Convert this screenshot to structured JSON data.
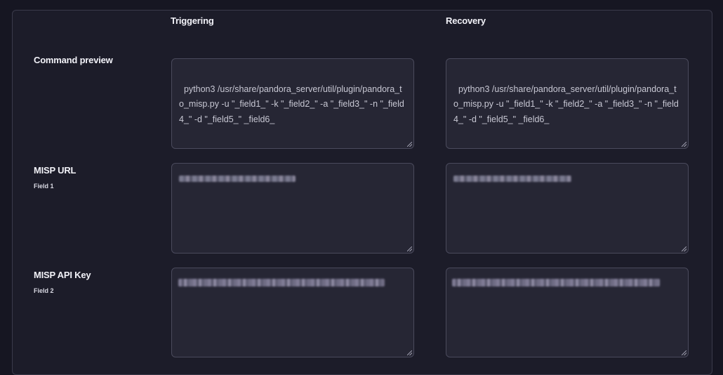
{
  "columns": {
    "triggering": "Triggering",
    "recovery": "Recovery"
  },
  "rows": {
    "command_preview": {
      "label": "Command preview",
      "triggering_value": "python3 /usr/share/pandora_server/util/plugin/pandora_to_misp.py -u \"_field1_\" -k \"_field2_\" -a \"_field3_\" -n \"_field4_\" -d \"_field5_\" _field6_",
      "recovery_value": "python3 /usr/share/pandora_server/util/plugin/pandora_to_misp.py -u \"_field1_\" -k \"_field2_\" -a \"_field3_\" -n \"_field4_\" -d \"_field5_\" _field6_"
    },
    "misp_url": {
      "label": "MISP URL",
      "sublabel": "Field 1"
    },
    "misp_api_key": {
      "label": "MISP API Key",
      "sublabel": "Field 2"
    }
  }
}
